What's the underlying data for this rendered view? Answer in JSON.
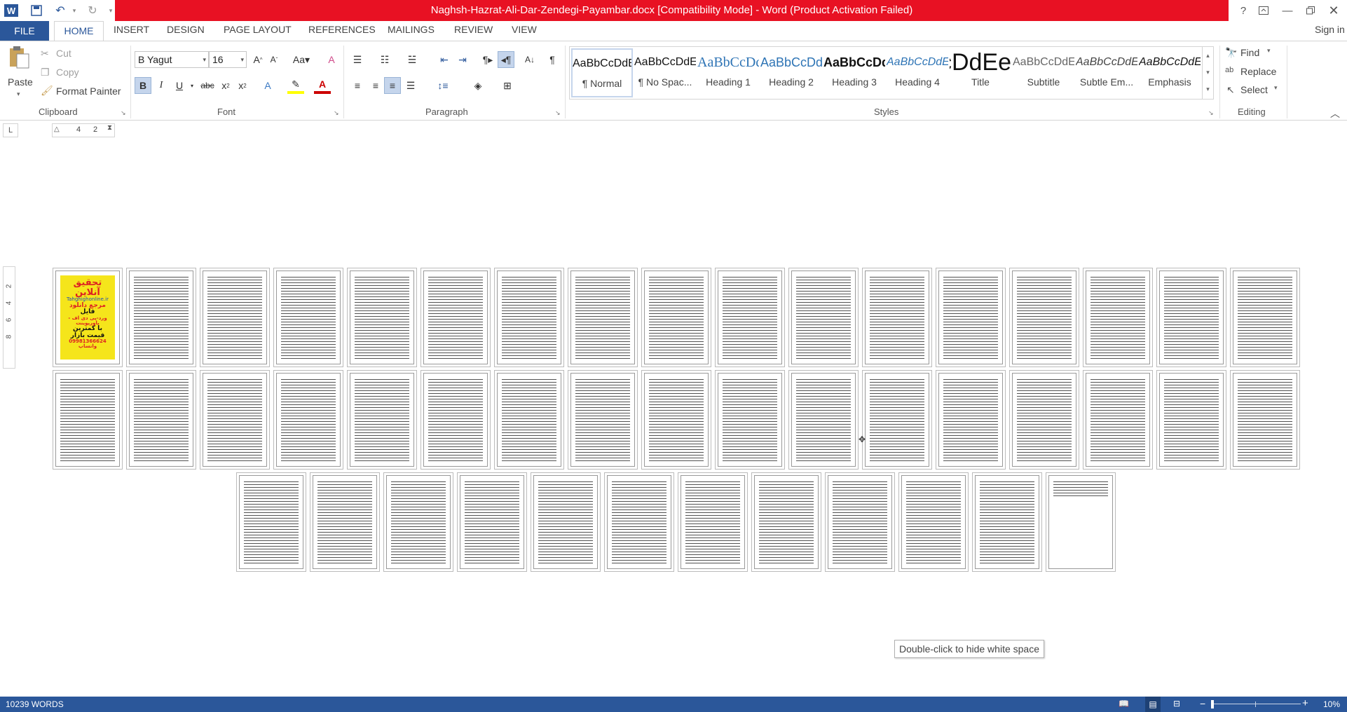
{
  "window": {
    "title": "Naghsh-Hazrat-Ali-Dar-Zendegi-Payambar.docx [Compatibility Mode] -  Word (Product Activation Failed)",
    "help_label": "?",
    "sign_in": "Sign in"
  },
  "tabs": {
    "file": "FILE",
    "home": "HOME",
    "insert": "INSERT",
    "design": "DESIGN",
    "page_layout": "PAGE LAYOUT",
    "references": "REFERENCES",
    "mailings": "MAILINGS",
    "review": "REVIEW",
    "view": "VIEW"
  },
  "clipboard": {
    "paste": "Paste",
    "cut": "Cut",
    "copy": "Copy",
    "format_painter": "Format Painter",
    "group_label": "Clipboard"
  },
  "font": {
    "name": "B Yagut",
    "size": "16",
    "group_label": "Font"
  },
  "paragraph": {
    "group_label": "Paragraph"
  },
  "styles": {
    "group_label": "Styles",
    "items": [
      {
        "preview": "AaBbCcDdEe",
        "name": "¶ Normal"
      },
      {
        "preview": "AaBbCcDdEe",
        "name": "¶ No Spac..."
      },
      {
        "preview": "AaBbCcDdEe",
        "name": "Heading 1"
      },
      {
        "preview": "AaBbCcDdEe",
        "name": "Heading 2"
      },
      {
        "preview": "AaBbCcDdEe",
        "name": "Heading 3"
      },
      {
        "preview": "AaBbCcDdEe",
        "name": "Heading 4"
      },
      {
        "preview": "AaBbCcDdEe",
        "name": "Title"
      },
      {
        "preview": "AaBbCcDdEe",
        "name": "Subtitle"
      },
      {
        "preview": "AaBbCcDdEe",
        "name": "Subtle Em..."
      },
      {
        "preview": "AaBbCcDdEe",
        "name": "Emphasis"
      }
    ]
  },
  "editing": {
    "find": "Find",
    "replace": "Replace",
    "select": "Select",
    "group_label": "Editing"
  },
  "ruler": {
    "horizontal_marks": [
      "4",
      "2"
    ],
    "vertical_marks": [
      "2",
      "4",
      "6",
      "8"
    ]
  },
  "ad_page": {
    "line1": "تحقیق آنلاین",
    "line2": "Tahghighonline.ir",
    "line3": "مرجع دانلود",
    "line4": "فایل",
    "line5": "ورد-پی دی اف - پاورپوینت",
    "line6": "با کمترین قیمت بازار",
    "line7": "09981366624 واتساپ"
  },
  "tooltip": "Double-click to hide white space",
  "status": {
    "words": "10239 WORDS",
    "zoom": "10%"
  },
  "colors": {
    "title_bar_error": "#e81123",
    "brand_blue": "#2b579a",
    "status_bar": "#2b579a"
  }
}
